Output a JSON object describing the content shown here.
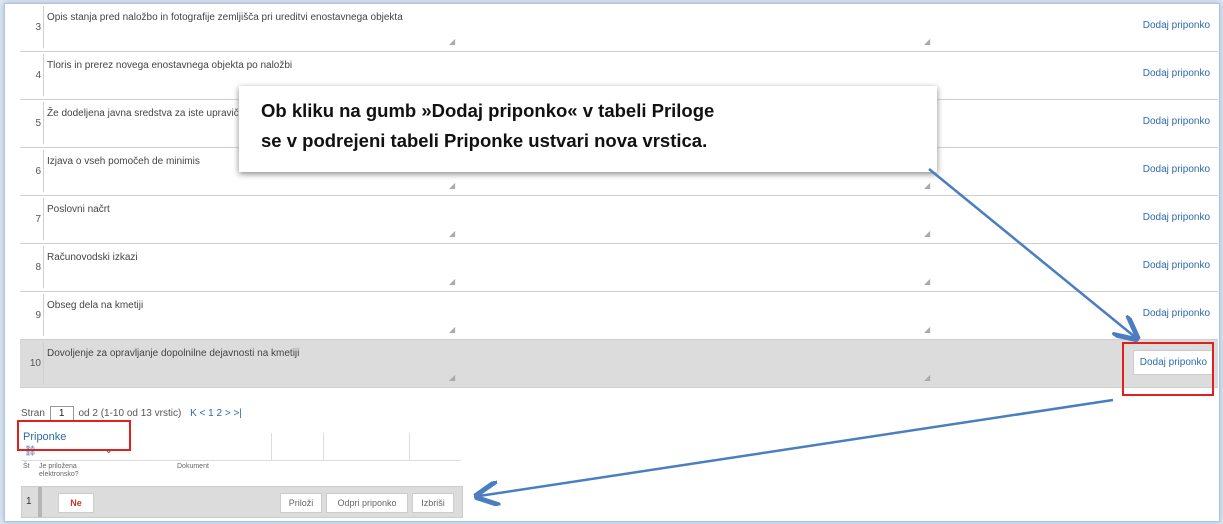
{
  "attachments_table": {
    "rows": [
      {
        "num": "3",
        "desc": "Opis stanja pred naložbo in fotografije zemljišča pri ureditvi enostavnega objekta",
        "action": "Dodaj priponko"
      },
      {
        "num": "4",
        "desc": "Tloris in prerez novega enostavnega objekta po naložbi",
        "action": "Dodaj priponko"
      },
      {
        "num": "5",
        "desc": "Že dodeljena javna sredstva za iste upravičene stroške",
        "action": "Dodaj priponko"
      },
      {
        "num": "6",
        "desc": "Izjava o vseh pomočeh de minimis",
        "action": "Dodaj priponko"
      },
      {
        "num": "7",
        "desc": "Poslovni načrt",
        "action": "Dodaj priponko"
      },
      {
        "num": "8",
        "desc": "Računovodski izkazi",
        "action": "Dodaj priponko"
      },
      {
        "num": "9",
        "desc": "Obseg dela na kmetiji",
        "action": "Dodaj priponko"
      },
      {
        "num": "10",
        "desc": "Dovoljenje za opravljanje dopolnilne dejavnosti na kmetiji",
        "action": "Dodaj priponko"
      }
    ]
  },
  "callout": {
    "line1": "Ob kliku na gumb »Dodaj priponko« v tabeli Priloge",
    "line2": "se v podrejeni tabeli Priponke ustvari nova vrstica."
  },
  "pager": {
    "label": "Stran",
    "page": "1",
    "summary": "od 2 (1-10 od 13 vrstic)",
    "nav": "K < 1 2 > >|"
  },
  "subtable": {
    "title": "Priponke",
    "headers": {
      "num": "Št",
      "electronic": "Je priložena elektronsko?",
      "document": "Dokument"
    },
    "row": {
      "num": "1",
      "electronic": "Ne",
      "attach": "Priloži",
      "open": "Odpri priponko",
      "delete": "Izbriši"
    }
  },
  "colors": {
    "accent": "#2b6ab0",
    "highlight": "#e0201c",
    "arrow": "#4a7ec0"
  }
}
